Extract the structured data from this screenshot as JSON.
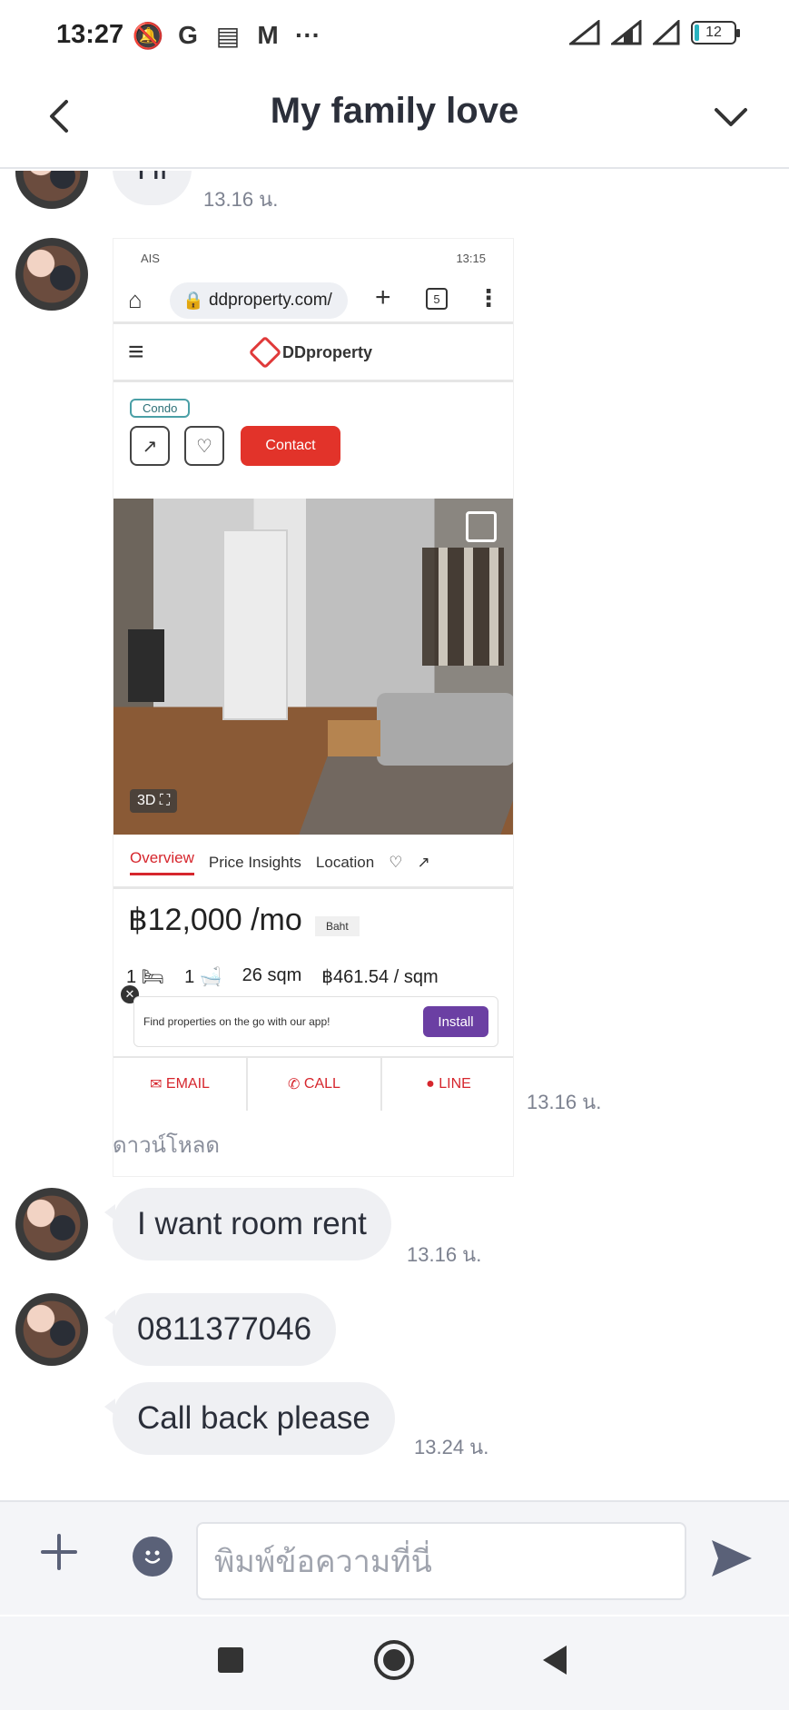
{
  "status_bar": {
    "time": "13:27",
    "icons": [
      "bell-off-icon",
      "google-icon",
      "news-icon",
      "gmail-icon",
      "more-dots-icon"
    ],
    "glyphs": [
      "🔕",
      "G",
      "▤",
      "M",
      "···"
    ],
    "battery": "12"
  },
  "header": {
    "title": "My family love"
  },
  "messages": [
    {
      "type": "text",
      "text": "Hi",
      "time": "13.16 น."
    },
    {
      "type": "image",
      "time": "13.16 น.",
      "download_label": "ดาวน์โหลด",
      "shot": {
        "status_left": "AIS",
        "status_right": "13:15",
        "url": "ddproperty.com/",
        "tab_count": "5",
        "logo": "DDproperty",
        "tag": "Condo",
        "contact": "Contact",
        "three_d": "3D",
        "tabs": [
          "Overview",
          "Price Insights",
          "Location"
        ],
        "price": "฿12,000 /mo",
        "badge": "Baht",
        "specs": [
          "1",
          "1",
          "26 sqm",
          "฿461.54 / sqm"
        ],
        "banner_text": "Find properties on the go with our app!",
        "install": "Install",
        "actions": [
          "EMAIL",
          "CALL",
          "LINE"
        ]
      }
    },
    {
      "type": "text",
      "text": "I want room rent",
      "time": "13.16 น."
    },
    {
      "type": "text",
      "text": "0811377046"
    },
    {
      "type": "text",
      "text": "Call back please",
      "time": "13.24 น."
    }
  ],
  "input": {
    "placeholder": "พิมพ์ข้อความที่นี่"
  },
  "colors": {
    "bubble": "#eff0f3",
    "accent": "#5a6178",
    "text": "#2b2f3a"
  }
}
